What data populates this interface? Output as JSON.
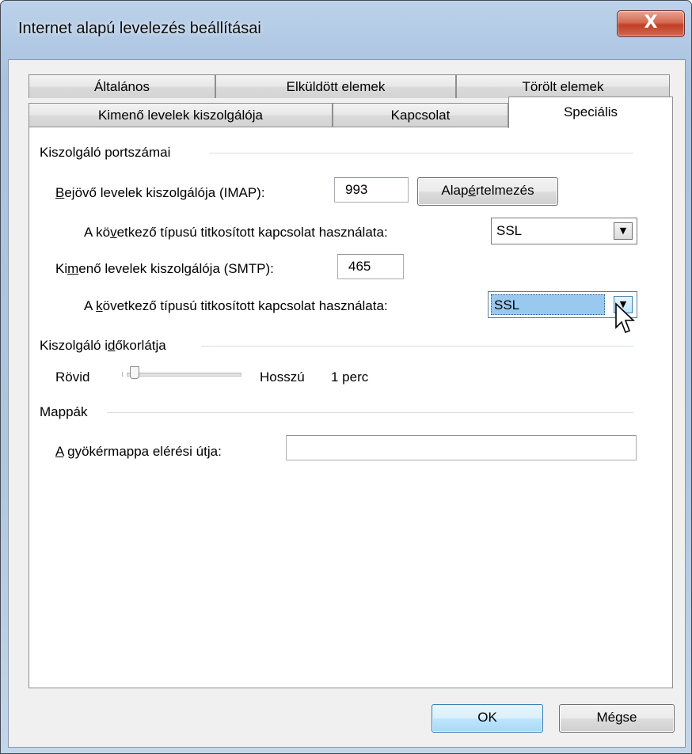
{
  "window": {
    "title": "Internet alapú levelezés beállításai",
    "close_glyph": "X"
  },
  "tabs": {
    "row1": [
      "Általános",
      "Elküldött elemek",
      "Törölt elemek"
    ],
    "row2": [
      "Kimenő levelek kiszolgálója",
      "Kapcsolat"
    ],
    "active": "Speciális"
  },
  "ports": {
    "group_label": "Kiszolgáló portszámai",
    "imap_label_pre": "",
    "imap_label_u": "B",
    "imap_label_post": "ejövő levelek kiszolgálója (IMAP):",
    "imap_value": "993",
    "default_btn_pre": "Alap",
    "default_btn_u": "é",
    "default_btn_post": "rtelmezés",
    "enc1_pre": "A kö",
    "enc1_u": "v",
    "enc1_post": "etkező típusú titkosított kapcsolat használata:",
    "enc1_value": "SSL",
    "smtp_pre": "Ki",
    "smtp_u": "m",
    "smtp_post": "enő levelek kiszolgálója (SMTP):",
    "smtp_value": "465",
    "enc2_pre": "A ",
    "enc2_u": "k",
    "enc2_post": "övetkező típusú titkosított kapcsolat használata:",
    "enc2_value": "SSL"
  },
  "timeout": {
    "group_label_pre": "Kiszolgáló i",
    "group_label_u": "d",
    "group_label_post": "őkorlátja",
    "short": "Rövid",
    "long": "Hosszú",
    "value": "1 perc",
    "slider_fraction": 0.0
  },
  "folders": {
    "group_label": "Mappák",
    "root_u": "A",
    "root_post": " gyökérmappa elérési útja:",
    "root_value": ""
  },
  "buttons": {
    "ok": "OK",
    "cancel": "Mégse"
  },
  "colors": {
    "selection": "#99c9ef",
    "close_red": "#c23f25",
    "frame": "#aec6e0"
  }
}
